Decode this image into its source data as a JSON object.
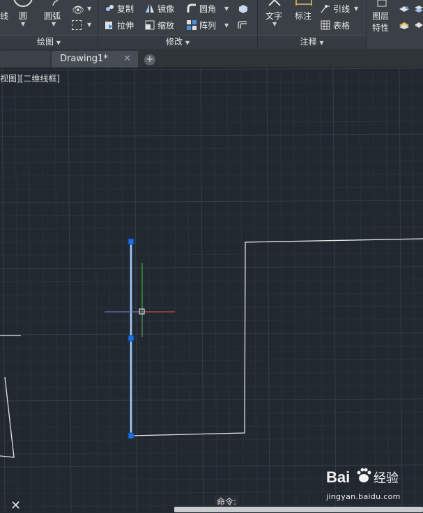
{
  "ribbon": {
    "draw_panel": {
      "title": "绘图",
      "tools": {
        "polyline_partial": "线",
        "circle": "圆",
        "arc": "圆弧"
      }
    },
    "modify_panel": {
      "title": "修改",
      "tools": {
        "copy": "复制",
        "mirror": "镜像",
        "fillet": "圆角",
        "stretch": "拉伸",
        "scale": "缩放",
        "array": "阵列"
      }
    },
    "annotation_panel": {
      "title": "注释",
      "tools": {
        "text": "文字",
        "dimension": "标注",
        "leader": "引线",
        "table": "表格"
      }
    },
    "layers_panel": {
      "layer_properties_line1": "图层",
      "layer_properties_line2": "特性"
    }
  },
  "tabs": {
    "active": "Drawing1*",
    "close_glyph": "✕",
    "add_glyph": "+"
  },
  "viewport": {
    "label": "视图][二维线框]"
  },
  "command": {
    "label": "命令:"
  },
  "watermark": {
    "brand": "Bai",
    "brand_cn": "经验",
    "url": "jingyan.baidu.com"
  },
  "colors": {
    "background": "#212830",
    "grip": "#1f6fe0",
    "selected_line": "#4aa3ff",
    "x_axis": "#e05050",
    "y_axis": "#40c040"
  }
}
